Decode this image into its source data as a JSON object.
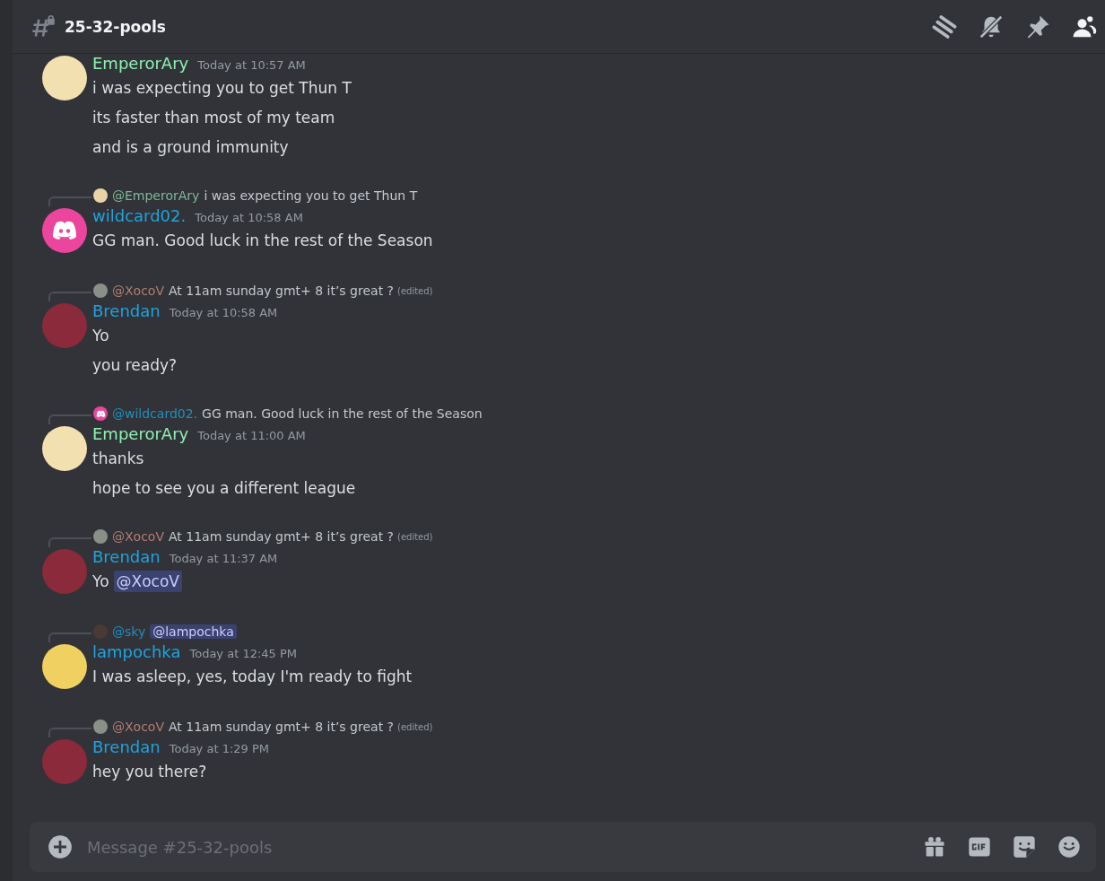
{
  "channel": {
    "name": "25-32-pools"
  },
  "messages": [
    {
      "author": {
        "name": "EmperorAry",
        "color": "#8ef0b0"
      },
      "avatar": {
        "kind": "picture",
        "color": "#f2e0b0"
      },
      "time": "Today at 10:57 AM",
      "lines": [
        {
          "text": "i was expecting you to get Thun T"
        },
        {
          "text": "its faster than most of my team"
        },
        {
          "text": "and is a ground immunity"
        }
      ]
    },
    {
      "reply": {
        "author": {
          "name": "@EmperorAry",
          "color": "#7fb894"
        },
        "avatar": {
          "kind": "picture",
          "color": "#e8d4a8"
        },
        "text": "i was expecting you to get Thun T"
      },
      "author": {
        "name": "wildcard02.",
        "color": "#1fa3e0"
      },
      "avatar": {
        "kind": "default",
        "color": "#eb459e"
      },
      "time": "Today at 10:58 AM",
      "lines": [
        {
          "text": "GG man. Good luck in the rest of the Season"
        }
      ]
    },
    {
      "reply": {
        "author": {
          "name": "@XocoV",
          "color": "#b57c72"
        },
        "avatar": {
          "kind": "picture",
          "color": "#8a8f88"
        },
        "text": "At 11am sunday gmt+ 8 it’s great ?",
        "edited": "(edited)"
      },
      "author": {
        "name": "Brendan",
        "color": "#1fa3e0"
      },
      "avatar": {
        "kind": "picture",
        "color": "#8a2a3a"
      },
      "time": "Today at 10:58 AM",
      "lines": [
        {
          "text": "Yo"
        },
        {
          "text": "you ready?"
        }
      ]
    },
    {
      "reply": {
        "author": {
          "name": "@wildcard02.",
          "color": "#1f8fc0"
        },
        "avatar": {
          "kind": "default",
          "color": "#eb459e"
        },
        "text": "GG man. Good luck in the rest of the Season"
      },
      "author": {
        "name": "EmperorAry",
        "color": "#8ef0b0"
      },
      "avatar": {
        "kind": "picture",
        "color": "#f2e0b0"
      },
      "time": "Today at 11:00 AM",
      "lines": [
        {
          "text": "thanks"
        },
        {
          "text": "hope to see you a different league"
        }
      ]
    },
    {
      "reply": {
        "author": {
          "name": "@XocoV",
          "color": "#b57c72"
        },
        "avatar": {
          "kind": "picture",
          "color": "#8a8f88"
        },
        "text": "At 11am sunday gmt+ 8 it’s great ?",
        "edited": "(edited)"
      },
      "author": {
        "name": "Brendan",
        "color": "#1fa3e0"
      },
      "avatar": {
        "kind": "picture",
        "color": "#8a2a3a"
      },
      "time": "Today at 11:37 AM",
      "lines": [
        {
          "text": "Yo",
          "mention": "@XocoV"
        }
      ]
    },
    {
      "reply": {
        "author": {
          "name": "@sky",
          "color": "#1f8fc0"
        },
        "avatar": {
          "kind": "picture",
          "color": "#4a3a36"
        },
        "mention": "@lampochka"
      },
      "author": {
        "name": "lampochka",
        "color": "#1fa3e0"
      },
      "avatar": {
        "kind": "picture",
        "color": "#f0d060"
      },
      "time": "Today at 12:45 PM",
      "lines": [
        {
          "text": "I was asleep, yes, today I'm ready to fight"
        }
      ]
    },
    {
      "reply": {
        "author": {
          "name": "@XocoV",
          "color": "#b57c72"
        },
        "avatar": {
          "kind": "picture",
          "color": "#8a8f88"
        },
        "text": "At 11am sunday gmt+ 8 it’s great ?",
        "edited": "(edited)"
      },
      "author": {
        "name": "Brendan",
        "color": "#1fa3e0"
      },
      "avatar": {
        "kind": "picture",
        "color": "#8a2a3a"
      },
      "time": "Today at 1:29 PM",
      "lines": [
        {
          "text": "hey you there?"
        }
      ]
    }
  ],
  "composer": {
    "placeholder": "Message #25-32-pools"
  }
}
